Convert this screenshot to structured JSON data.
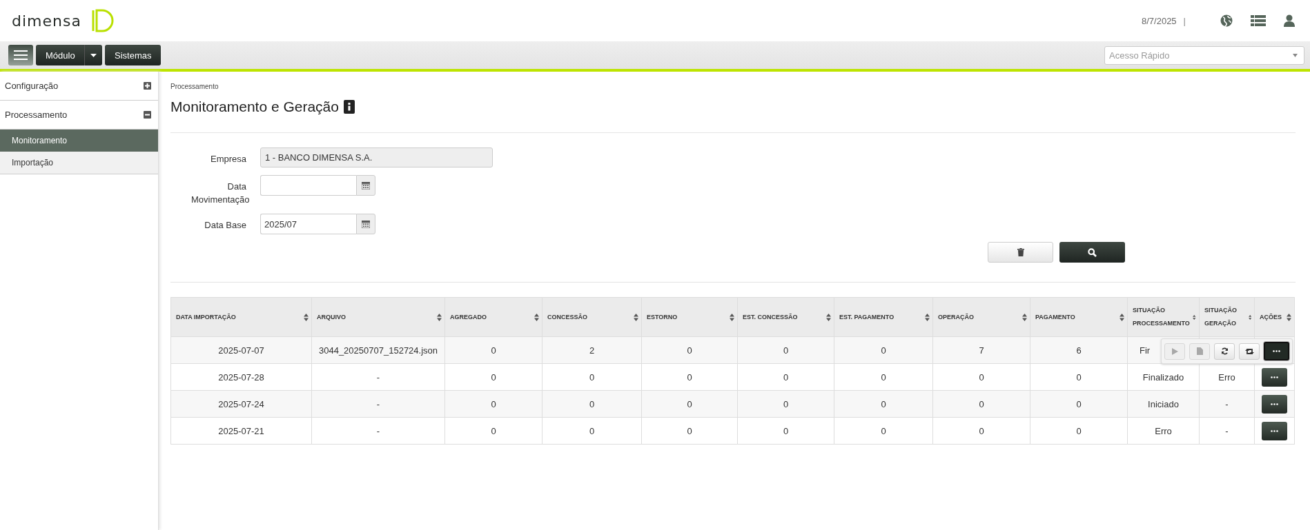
{
  "header": {
    "logo": "dimensa",
    "date": "8/7/2025",
    "separator": "|"
  },
  "toolbar": {
    "modulo": "Módulo",
    "sistemas": "Sistemas",
    "quick_access": {
      "placeholder": "Acesso Rápido"
    }
  },
  "sidebar": {
    "items": [
      {
        "label": "Configuração",
        "expanded": false
      },
      {
        "label": "Processamento",
        "expanded": true,
        "children": [
          {
            "label": "Monitoramento",
            "selected": true
          },
          {
            "label": "Importação",
            "selected": false
          }
        ]
      }
    ]
  },
  "breadcrumb": "Processamento",
  "title": "Monitoramento e Geração",
  "form": {
    "fields": [
      {
        "label": "Empresa",
        "value": "1 - BANCO DIMENSA S.A.",
        "kind": "text",
        "disabled": true
      },
      {
        "label": "Data Movimentação",
        "kind": "date",
        "disabled": false
      },
      {
        "label": "Data Base",
        "value": "2025/07",
        "kind": "date",
        "disabled": false
      }
    ]
  },
  "table": {
    "columns": [
      "DATA IMPORTAÇÃO",
      "ARQUIVO",
      "AGREGADO",
      "CONCESSÃO",
      "ESTORNO",
      "EST. CONCESSÃO",
      "EST. PAGAMENTO",
      "OPERAÇÃO",
      "PAGAMENTO",
      "SITUAÇÃO PROCESSAMENTO",
      "SITUAÇÃO GERAÇÃO",
      "AÇÕES"
    ],
    "rows": [
      {
        "cells": [
          "2025-07-07",
          "3044_20250707_152724.json",
          "0",
          "2",
          "0",
          "0",
          "0",
          "7",
          "6",
          "Fir"
        ],
        "menu_open": true,
        "actions": [
          {
            "kind": "play",
            "disabled": true
          },
          {
            "kind": "file",
            "disabled": true
          },
          {
            "kind": "refresh",
            "disabled": false
          },
          {
            "kind": "retweet",
            "disabled": false
          }
        ]
      },
      {
        "cells": [
          "2025-07-28",
          "-",
          "0",
          "0",
          "0",
          "0",
          "0",
          "0",
          "0",
          "Finalizado",
          "Erro"
        ],
        "menu_open": false
      },
      {
        "cells": [
          "2025-07-24",
          "-",
          "0",
          "0",
          "0",
          "0",
          "0",
          "0",
          "0",
          "Iniciado",
          "-"
        ],
        "menu_open": false
      },
      {
        "cells": [
          "2025-07-21",
          "-",
          "0",
          "0",
          "0",
          "0",
          "0",
          "0",
          "0",
          "Erro",
          "-"
        ],
        "menu_open": false
      }
    ]
  }
}
